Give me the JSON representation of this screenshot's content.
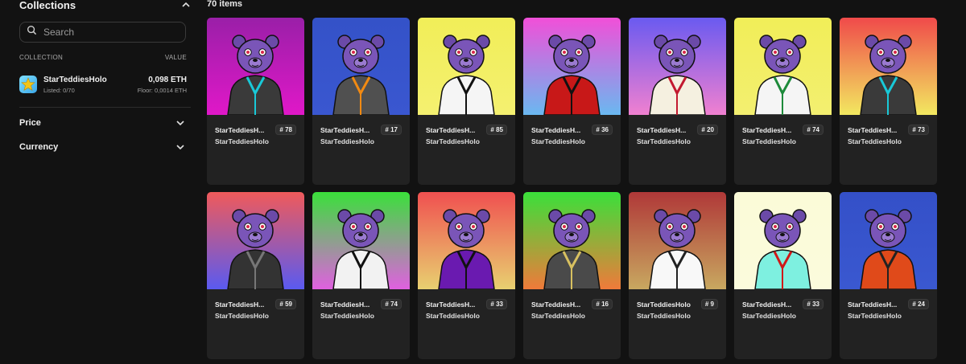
{
  "sidebar": {
    "collections_title": "Collections",
    "search_placeholder": "Search",
    "col_header_collection": "COLLECTION",
    "col_header_value": "VALUE",
    "collection": {
      "name": "StarTeddiesHolo",
      "listed": "Listed: 0/70",
      "value": "0,098 ETH",
      "floor": "Floor: 0,0014 ETH"
    },
    "filters": [
      {
        "label": "Price"
      },
      {
        "label": "Currency"
      }
    ]
  },
  "items_count": "70 items",
  "cards": [
    {
      "name": "StarTeddiesH...",
      "badge": "# 78",
      "collection": "StarTeddiesHolo",
      "bg_top": "#9a1fa8",
      "bg_bottom": "#e018c8",
      "outfit": "#3a3a3a",
      "accent": "#19c9d8"
    },
    {
      "name": "StarTeddiesH...",
      "badge": "# 17",
      "collection": "StarTeddiesHolo",
      "bg_top": "#3452c8",
      "bg_bottom": "#3a57d0",
      "outfit": "#505050",
      "accent": "#f28a12"
    },
    {
      "name": "StarTeddiesH...",
      "badge": "# 85",
      "collection": "StarTeddiesHolo",
      "bg_top": "#f1ee58",
      "bg_bottom": "#f4f070",
      "outfit": "#f5f5f5",
      "accent": "#111111"
    },
    {
      "name": "StarTeddiesH...",
      "badge": "# 36",
      "collection": "StarTeddiesHolo",
      "bg_top": "#f14fd8",
      "bg_bottom": "#6ab8f0",
      "outfit": "#c81818",
      "accent": "#111111"
    },
    {
      "name": "StarTeddiesH...",
      "badge": "# 20",
      "collection": "StarTeddiesHolo",
      "bg_top": "#6a5af0",
      "bg_bottom": "#f080d0",
      "outfit": "#f5f0e0",
      "accent": "#c21a30"
    },
    {
      "name": "StarTeddiesH...",
      "badge": "# 74",
      "collection": "StarTeddiesHolo",
      "bg_top": "#f1ee58",
      "bg_bottom": "#f3ef70",
      "outfit": "#f5f5f5",
      "accent": "#1d8a3a"
    },
    {
      "name": "StarTeddiesH...",
      "badge": "# 73",
      "collection": "StarTeddiesHolo",
      "bg_top": "#f04a4a",
      "bg_bottom": "#f2e860",
      "outfit": "#3a3a3a",
      "accent": "#19c9d8"
    },
    {
      "name": "StarTeddiesH...",
      "badge": "# 59",
      "collection": "StarTeddiesHolo",
      "bg_top": "#f05a5a",
      "bg_bottom": "#5a5af0",
      "outfit": "#333333",
      "accent": "#777777"
    },
    {
      "name": "StarTeddiesH...",
      "badge": "# 74",
      "collection": "StarTeddiesHolo",
      "bg_top": "#3ae03a",
      "bg_bottom": "#e060e0",
      "outfit": "#f2f2f2",
      "accent": "#111111"
    },
    {
      "name": "StarTeddiesH...",
      "badge": "# 33",
      "collection": "StarTeddiesHolo",
      "bg_top": "#f05050",
      "bg_bottom": "#e8d070",
      "outfit": "#6a1ab0",
      "accent": "#111111"
    },
    {
      "name": "StarTeddiesH...",
      "badge": "# 16",
      "collection": "StarTeddiesHolo",
      "bg_top": "#3ae03a",
      "bg_bottom": "#f07a3a",
      "outfit": "#4a4a4a",
      "accent": "#d8c060"
    },
    {
      "name": "StarTeddiesHolo",
      "badge": "# 9",
      "collection": "StarTeddiesHolo",
      "bg_top": "#b03838",
      "bg_bottom": "#c8a860",
      "outfit": "#f8f8f8",
      "accent": "#222222"
    },
    {
      "name": "StarTeddiesH...",
      "badge": "# 33",
      "collection": "StarTeddiesHolo",
      "bg_top": "#fbfbd8",
      "bg_bottom": "#fbfbdc",
      "outfit": "#7ef0e0",
      "accent": "#d01818"
    },
    {
      "name": "StarTeddiesH...",
      "badge": "# 24",
      "collection": "StarTeddiesHolo",
      "bg_top": "#3450c8",
      "bg_bottom": "#3a58d0",
      "outfit": "#e04a1a",
      "accent": "#222222"
    }
  ]
}
